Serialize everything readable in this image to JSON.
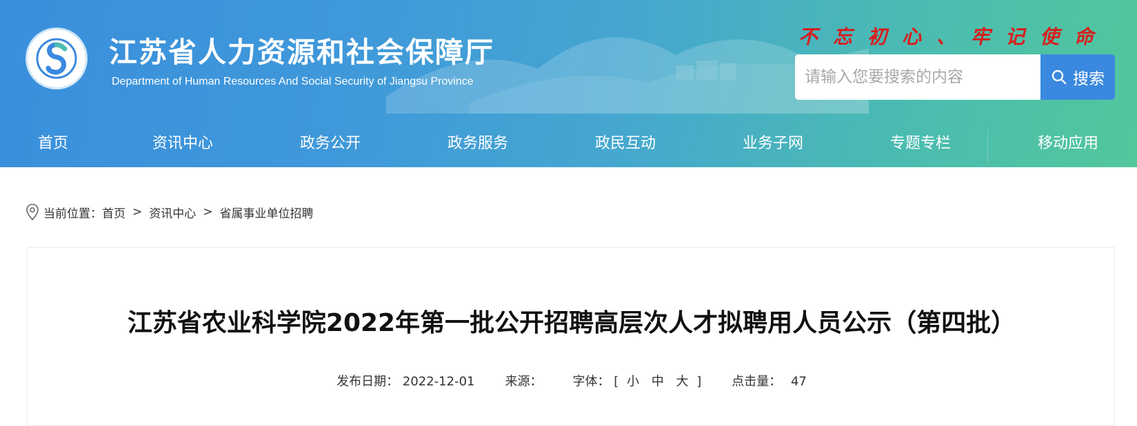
{
  "header": {
    "title": "江苏省人力资源和社会保障厅",
    "subtitle": "Department of Human Resources And Social Security of Jiangsu Province",
    "slogan": "不忘初心、牢记使命",
    "logo_ring_text": "江苏省人力资源和社会保障厅",
    "search": {
      "placeholder": "请输入您要搜索的内容",
      "button_label": "搜索",
      "button_icon": "search-icon"
    }
  },
  "nav": {
    "items": [
      {
        "label": "首页"
      },
      {
        "label": "资讯中心"
      },
      {
        "label": "政务公开"
      },
      {
        "label": "政务服务"
      },
      {
        "label": "政民互动"
      },
      {
        "label": "业务子网"
      },
      {
        "label": "专题专栏"
      },
      {
        "label": "移动应用"
      }
    ]
  },
  "breadcrumb": {
    "prefix": "当前位置：",
    "items": [
      "首页",
      "资讯中心",
      "省属事业单位招聘"
    ],
    "separator": ">",
    "icon": "location-pin-icon"
  },
  "article": {
    "title": "江苏省农业科学院2022年第一批公开招聘高层次人才拟聘用人员公示（第四批）",
    "meta": {
      "date_label": "发布日期：",
      "date_value": "2022-12-01",
      "source_label": "来源：",
      "source_value": "",
      "font_label": "字体：",
      "font_open": "[",
      "font_options": [
        "小",
        "中",
        "大"
      ],
      "font_close": "]",
      "hits_label": "点击量：",
      "hits_value": "47"
    }
  },
  "colors": {
    "header_gradient_start": "#3a8fdc",
    "header_gradient_end": "#52c79c",
    "slogan": "#d81e1e",
    "search_button": "#3a88df"
  }
}
